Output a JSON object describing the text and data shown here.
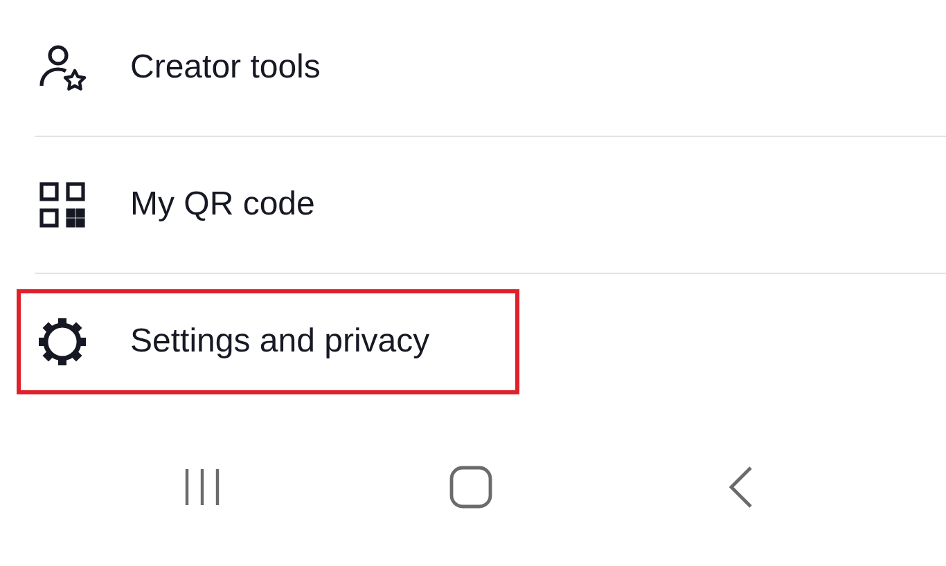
{
  "menu_items": [
    {
      "kind": "creator",
      "label": "Creator tools",
      "highlighted": false
    },
    {
      "kind": "qr",
      "label": "My QR code",
      "highlighted": false
    },
    {
      "kind": "settings",
      "label": "Settings and privacy",
      "highlighted": true
    }
  ]
}
